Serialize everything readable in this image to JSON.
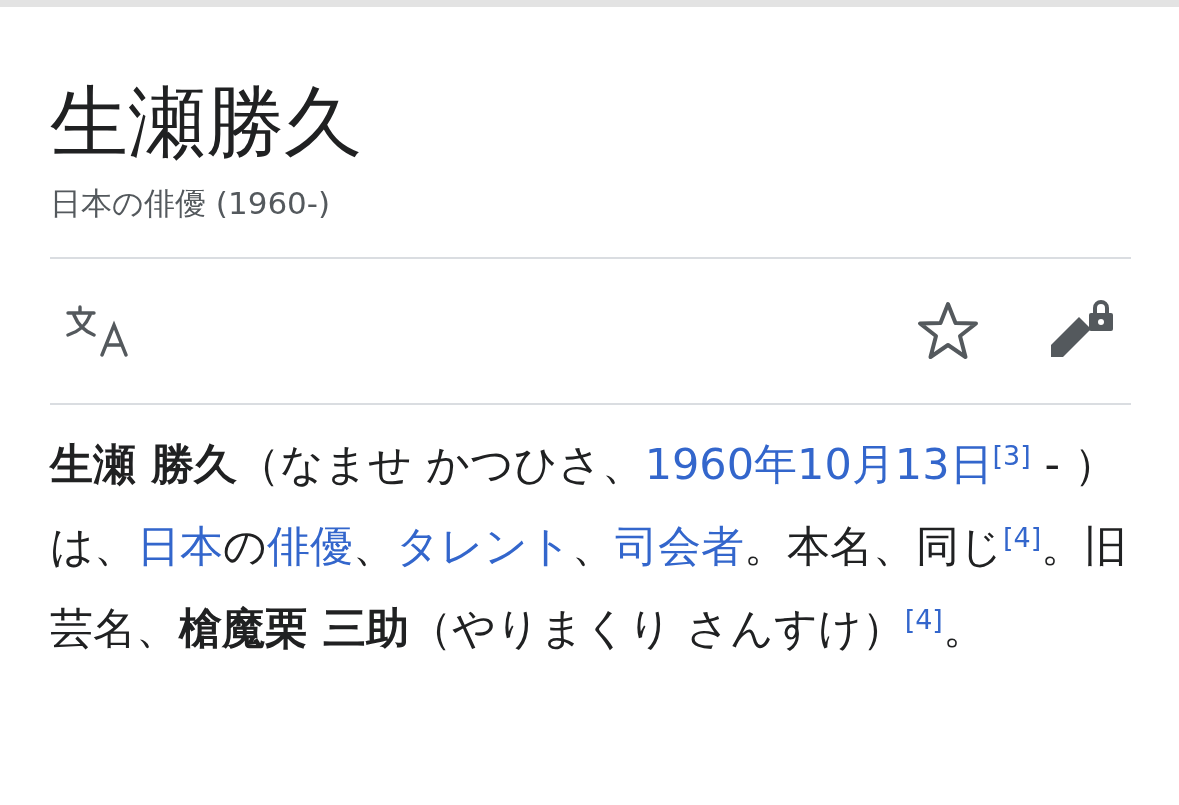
{
  "title": "生瀬勝久",
  "subtitle": "日本の俳優 (1960-)",
  "paragraph": [
    {
      "kind": "bold",
      "text": "生瀬 勝久"
    },
    {
      "kind": "text",
      "text": "（なませ かつひさ、"
    },
    {
      "kind": "link",
      "text": "1960年10月13日"
    },
    {
      "kind": "ref",
      "text": "[3]"
    },
    {
      "kind": "text",
      "text": " - ）は、"
    },
    {
      "kind": "link",
      "text": "日本"
    },
    {
      "kind": "text",
      "text": "の"
    },
    {
      "kind": "link",
      "text": "俳優"
    },
    {
      "kind": "text",
      "text": "、"
    },
    {
      "kind": "link",
      "text": "タレント"
    },
    {
      "kind": "text",
      "text": "、"
    },
    {
      "kind": "link",
      "text": "司会者"
    },
    {
      "kind": "text",
      "text": "。本名、同じ"
    },
    {
      "kind": "ref",
      "text": "[4]"
    },
    {
      "kind": "text",
      "text": "。旧芸名、"
    },
    {
      "kind": "bold",
      "text": "槍魔栗 三助"
    },
    {
      "kind": "text",
      "text": "（やりまくり さんすけ）"
    },
    {
      "kind": "ref",
      "text": "[4]"
    },
    {
      "kind": "text",
      "text": "。"
    }
  ]
}
